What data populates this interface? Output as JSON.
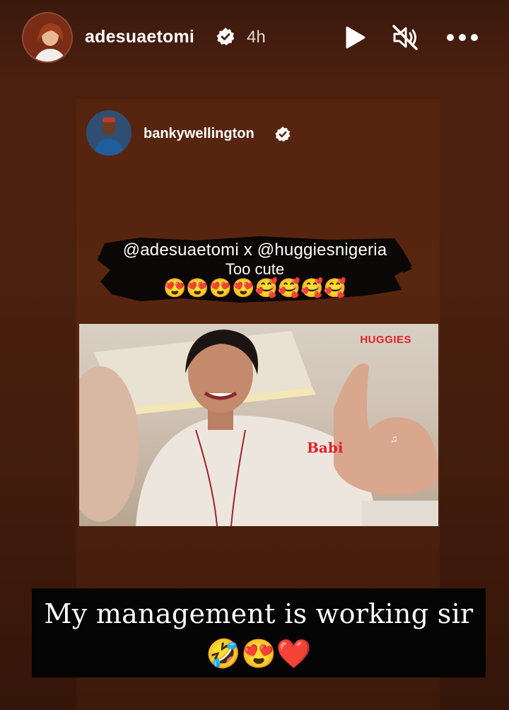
{
  "story": {
    "username": "adesuaetomi",
    "time": "4h",
    "avatar_icon": "profile-photo",
    "controls": {
      "play_icon": "play-icon",
      "mute_icon": "speaker-muted-icon",
      "more_icon": "more-horizontal-icon"
    }
  },
  "shared_post": {
    "username": "bankywellington",
    "caption": {
      "line1": "@adesuaetomi x @huggiesnigeria",
      "line2": "Too cute",
      "emojis": "😍😍😍😍🥰🥰🥰🥰"
    },
    "video": {
      "brand_logo": "HUGGIES",
      "overlay_text": "Babi"
    }
  },
  "overlay_caption": {
    "text": "My management is working sir",
    "emojis": "🤣😍❤️"
  },
  "colors": {
    "background": "#4a200f",
    "verified_badge": "#ffffff",
    "brand_red": "#e0202a"
  }
}
